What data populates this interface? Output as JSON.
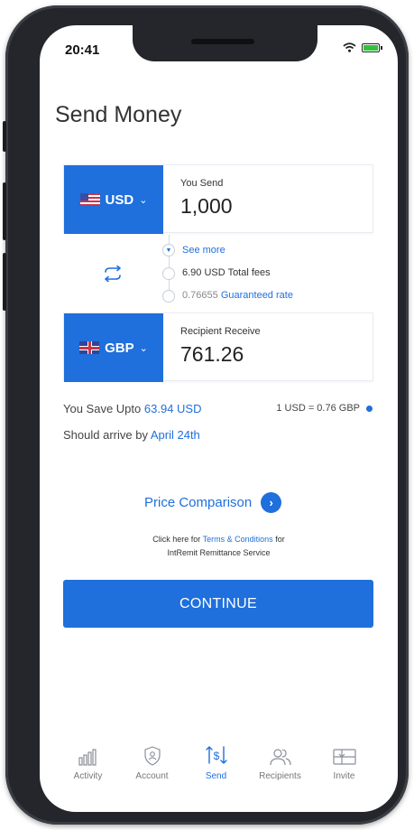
{
  "status_bar": {
    "time": "20:41"
  },
  "page": {
    "title": "Send Money"
  },
  "send": {
    "currency": "USD",
    "label": "You Send",
    "amount": "1,000"
  },
  "receive": {
    "currency": "GBP",
    "label": "Recipient Receive",
    "amount": "761.26"
  },
  "details": {
    "see_more": "See more",
    "fees_value": "6.90 USD",
    "fees_label": "Total fees",
    "rate_value": "0.76655",
    "rate_label": "Guaranteed rate"
  },
  "savings": {
    "label": "You Save Upto",
    "amount": "63.94 USD",
    "rate": "1 USD = 0.76 GBP",
    "arrive_label": "Should arrive by",
    "arrive_date": "April 24th"
  },
  "price_comparison": {
    "label": "Price Comparison"
  },
  "terms": {
    "prefix": "Click here for",
    "link": "Terms & Conditions",
    "suffix": "for",
    "line2": "IntRemit Remittance Service"
  },
  "continue_label": "CONTINUE",
  "tabs": [
    {
      "label": "Activity",
      "icon": "activity-chart-icon"
    },
    {
      "label": "Account",
      "icon": "account-shield-icon"
    },
    {
      "label": "Send",
      "icon": "send-transfer-icon",
      "active": true
    },
    {
      "label": "Recipients",
      "icon": "recipients-icon"
    },
    {
      "label": "Invite",
      "icon": "invite-gift-icon"
    }
  ],
  "colors": {
    "accent": "#1f6fdc",
    "frame": "#24262b"
  }
}
